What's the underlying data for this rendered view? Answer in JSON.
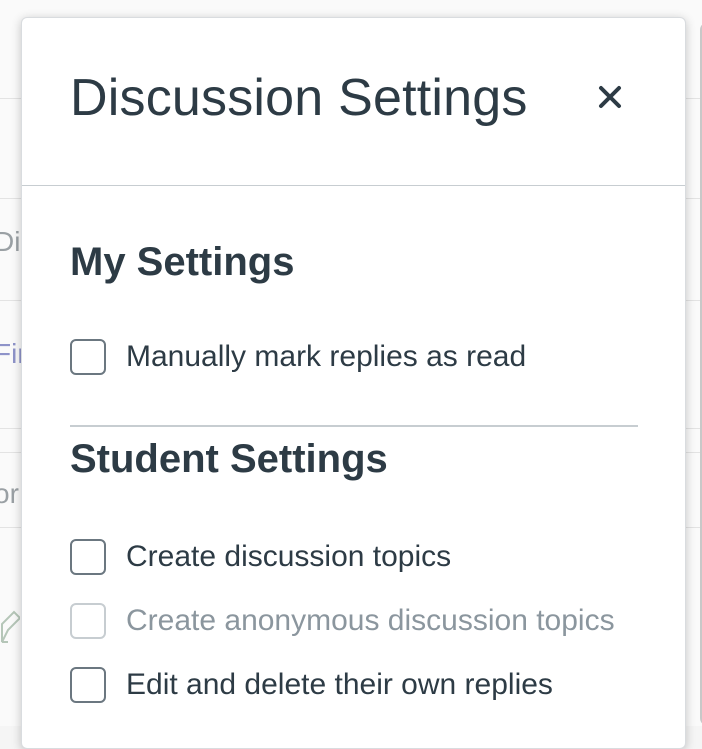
{
  "background": {
    "fragments": [
      "Di",
      "Fir",
      "or"
    ]
  },
  "modal": {
    "title": "Discussion Settings",
    "close_label": "×",
    "my_settings": {
      "heading": "My Settings",
      "options": [
        {
          "label": "Manually mark replies as read",
          "checked": false,
          "disabled": false
        }
      ]
    },
    "student_settings": {
      "heading": "Student Settings",
      "options": [
        {
          "label": "Create discussion topics",
          "checked": false,
          "disabled": false
        },
        {
          "label": "Create anonymous discussion topics",
          "checked": false,
          "disabled": true
        },
        {
          "label": "Edit and delete their own replies",
          "checked": false,
          "disabled": false
        }
      ]
    }
  },
  "colors": {
    "text": "#2d3b45",
    "disabled_text": "#8b969e",
    "border": "#c7cdd1"
  }
}
